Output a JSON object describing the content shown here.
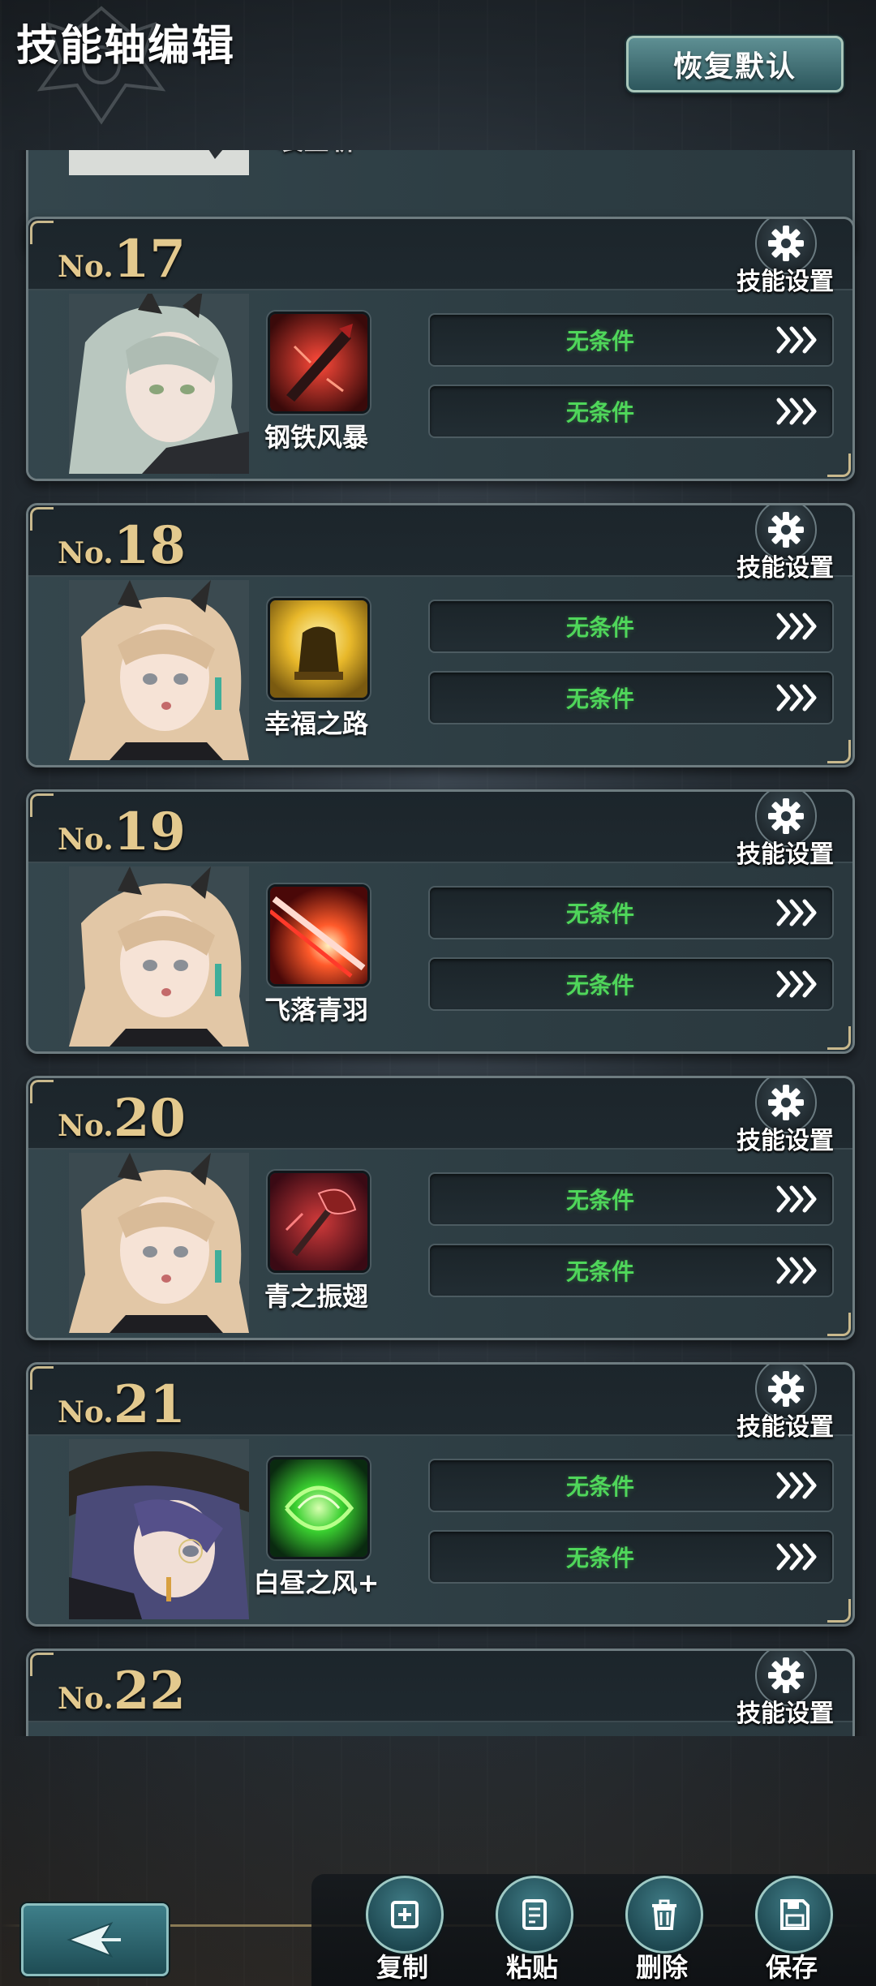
{
  "header": {
    "title": "技能轴编辑",
    "reset_label": "恢复默认"
  },
  "partial_top_card": {
    "skill_name": "裂空斩"
  },
  "cards": [
    {
      "no_prefix": "No.",
      "number": "17",
      "settings_label": "技能设置",
      "skill_name": "钢铁风暴",
      "conditions": [
        "无条件",
        "无条件"
      ],
      "portrait": "silver-haired-character-portrait",
      "skill_icon": "red-sword-skill-icon"
    },
    {
      "no_prefix": "No.",
      "number": "18",
      "settings_label": "技能设置",
      "skill_name": "幸福之路",
      "conditions": [
        "无条件",
        "无条件"
      ],
      "portrait": "blonde-horned-character-portrait",
      "skill_icon": "golden-shield-skill-icon"
    },
    {
      "no_prefix": "No.",
      "number": "19",
      "settings_label": "技能设置",
      "skill_name": "飞落青羽",
      "conditions": [
        "无条件",
        "无条件"
      ],
      "portrait": "blonde-horned-character-portrait",
      "skill_icon": "red-slash-skill-icon"
    },
    {
      "no_prefix": "No.",
      "number": "20",
      "settings_label": "技能设置",
      "skill_name": "青之振翅",
      "conditions": [
        "无条件",
        "无条件"
      ],
      "portrait": "blonde-horned-character-portrait",
      "skill_icon": "red-axe-skill-icon"
    },
    {
      "no_prefix": "No.",
      "number": "21",
      "settings_label": "技能设置",
      "skill_name": "白昼之风+",
      "conditions": [
        "无条件",
        "无条件"
      ],
      "portrait": "purple-haired-hat-character-portrait",
      "skill_icon": "green-wind-skill-icon"
    },
    {
      "no_prefix": "No.",
      "number": "22",
      "settings_label": "技能设置"
    }
  ],
  "toolbar": {
    "copy_label": "复制",
    "paste_label": "粘贴",
    "delete_label": "删除",
    "save_label": "保存"
  },
  "colors": {
    "accent_gold": "#e3c98e",
    "condition_green": "#4fd65a",
    "button_teal": "#2d575d"
  }
}
